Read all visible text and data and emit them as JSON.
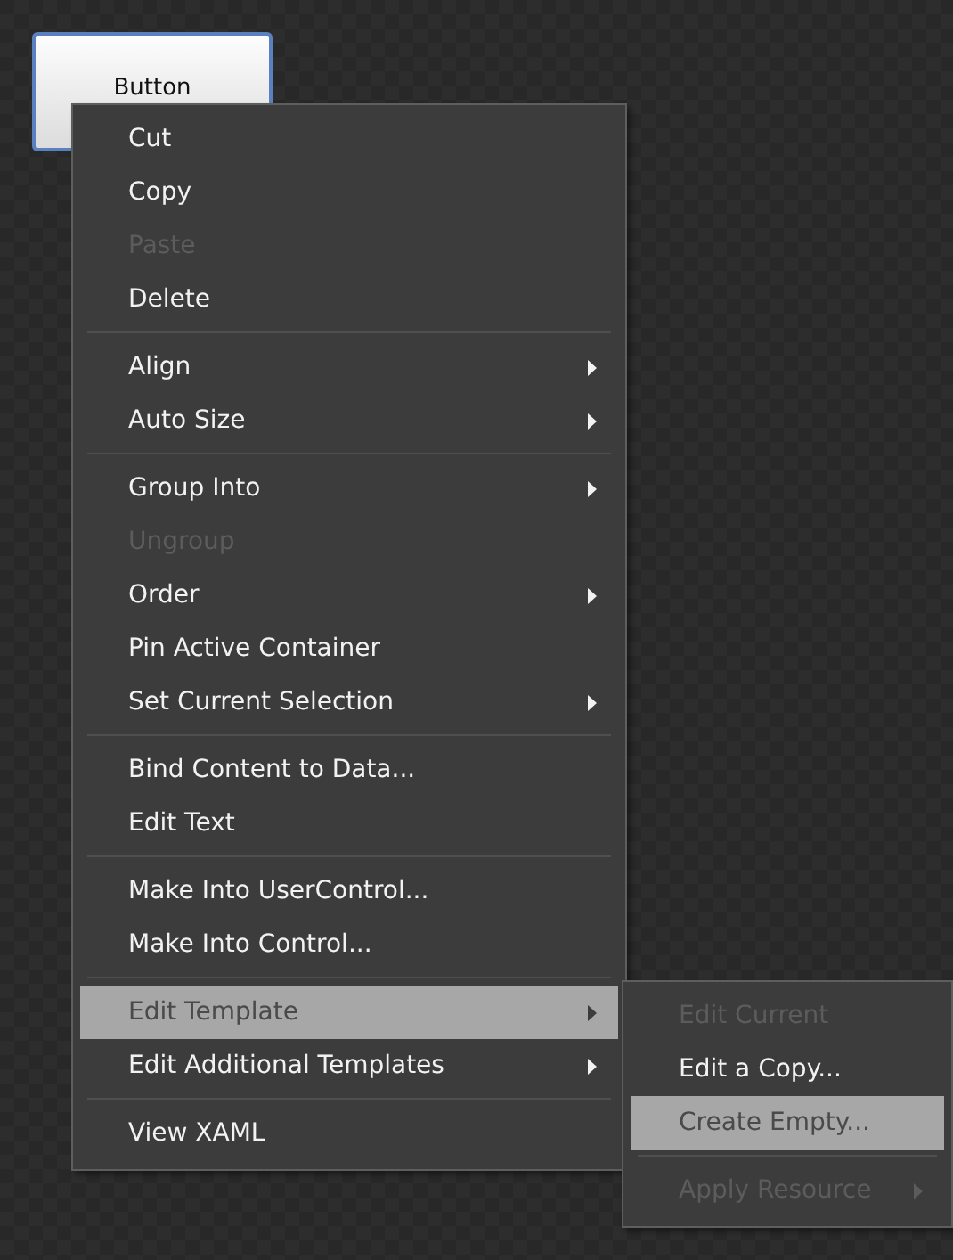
{
  "canvas_button": {
    "label": "Button"
  },
  "context_menu": {
    "items": [
      {
        "kind": "item",
        "label": "Cut",
        "disabled": false,
        "submenu": false,
        "selected": false
      },
      {
        "kind": "item",
        "label": "Copy",
        "disabled": false,
        "submenu": false,
        "selected": false
      },
      {
        "kind": "item",
        "label": "Paste",
        "disabled": true,
        "submenu": false,
        "selected": false
      },
      {
        "kind": "item",
        "label": "Delete",
        "disabled": false,
        "submenu": false,
        "selected": false
      },
      {
        "kind": "separator"
      },
      {
        "kind": "item",
        "label": "Align",
        "disabled": false,
        "submenu": true,
        "selected": false
      },
      {
        "kind": "item",
        "label": "Auto Size",
        "disabled": false,
        "submenu": true,
        "selected": false
      },
      {
        "kind": "separator"
      },
      {
        "kind": "item",
        "label": "Group Into",
        "disabled": false,
        "submenu": true,
        "selected": false
      },
      {
        "kind": "item",
        "label": "Ungroup",
        "disabled": true,
        "submenu": false,
        "selected": false
      },
      {
        "kind": "item",
        "label": "Order",
        "disabled": false,
        "submenu": true,
        "selected": false
      },
      {
        "kind": "item",
        "label": "Pin Active Container",
        "disabled": false,
        "submenu": false,
        "selected": false
      },
      {
        "kind": "item",
        "label": "Set Current Selection",
        "disabled": false,
        "submenu": true,
        "selected": false
      },
      {
        "kind": "separator"
      },
      {
        "kind": "item",
        "label": "Bind Content to Data...",
        "disabled": false,
        "submenu": false,
        "selected": false
      },
      {
        "kind": "item",
        "label": "Edit Text",
        "disabled": false,
        "submenu": false,
        "selected": false
      },
      {
        "kind": "separator"
      },
      {
        "kind": "item",
        "label": "Make Into UserControl...",
        "disabled": false,
        "submenu": false,
        "selected": false
      },
      {
        "kind": "item",
        "label": "Make Into Control...",
        "disabled": false,
        "submenu": false,
        "selected": false
      },
      {
        "kind": "separator"
      },
      {
        "kind": "item",
        "label": "Edit Template",
        "disabled": false,
        "submenu": true,
        "selected": true
      },
      {
        "kind": "item",
        "label": "Edit Additional Templates",
        "disabled": false,
        "submenu": true,
        "selected": false
      },
      {
        "kind": "separator"
      },
      {
        "kind": "item",
        "label": "View XAML",
        "disabled": false,
        "submenu": false,
        "selected": false
      }
    ]
  },
  "submenu": {
    "items": [
      {
        "kind": "item",
        "label": "Edit Current",
        "disabled": true,
        "submenu": false,
        "selected": false
      },
      {
        "kind": "item",
        "label": "Edit a Copy...",
        "disabled": false,
        "submenu": false,
        "selected": false
      },
      {
        "kind": "item",
        "label": "Create Empty...",
        "disabled": false,
        "submenu": false,
        "selected": true
      },
      {
        "kind": "separator"
      },
      {
        "kind": "item",
        "label": "Apply Resource",
        "disabled": true,
        "submenu": true,
        "selected": false
      }
    ]
  }
}
